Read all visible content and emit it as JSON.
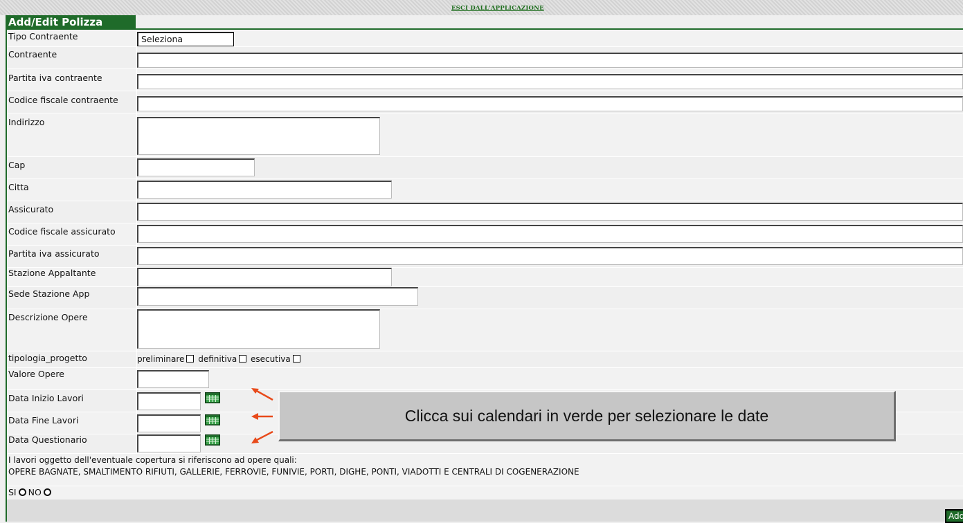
{
  "header": {
    "exit_link": "ESCI DALL'APPLICAZIONE",
    "title": "Add/Edit Polizza"
  },
  "form": {
    "tipo_contraente": {
      "label": "Tipo Contraente",
      "value": "Seleziona"
    },
    "contraente": {
      "label": "Contraente",
      "value": ""
    },
    "partita_iva_contraente": {
      "label": "Partita iva contraente",
      "value": ""
    },
    "codice_fiscale_contraente": {
      "label": "Codice fiscale contraente",
      "value": ""
    },
    "indirizzo": {
      "label": "Indirizzo",
      "value": ""
    },
    "cap": {
      "label": "Cap",
      "value": ""
    },
    "citta": {
      "label": "Citta",
      "value": ""
    },
    "assicurato": {
      "label": "Assicurato",
      "value": ""
    },
    "codice_fiscale_assicurato": {
      "label": "Codice fiscale assicurato",
      "value": ""
    },
    "partita_iva_assicurato": {
      "label": "Partita iva assicurato",
      "value": ""
    },
    "stazione_appaltante": {
      "label": "Stazione Appaltante",
      "value": ""
    },
    "sede_stazione_app": {
      "label": "Sede Stazione App",
      "value": ""
    },
    "descrizione_opere": {
      "label": "Descrizione Opere",
      "value": ""
    },
    "tipologia_progetto": {
      "label": "tipologia_progetto",
      "options": [
        "preliminare",
        "definitiva",
        "esecutiva"
      ]
    },
    "valore_opere": {
      "label": "Valore Opere",
      "value": ""
    },
    "data_inizio_lavori": {
      "label": "Data Inizio Lavori",
      "value": ""
    },
    "data_fine_lavori": {
      "label": "Data Fine Lavori",
      "value": ""
    },
    "data_questionario": {
      "label": "Data Questionario",
      "value": ""
    }
  },
  "question": {
    "line1": "I lavori oggetto dell'eventuale copertura si riferiscono ad opere quali:",
    "line2": "OPERE BAGNATE, SMALTIMENTO RIFIUTI, GALLERIE, FERROVIE, FUNIVIE, PORTI, DIGHE, PONTI, VIADOTTI E CENTRALI DI COGENERAZIONE",
    "si_label": "SI",
    "no_label": "NO"
  },
  "note": "Clicca sui calendari in verde per selezionare le date",
  "footer": {
    "add_button": "Add"
  },
  "colors": {
    "accent_green": "#1f6b2a",
    "arrow_orange": "#e84a1a"
  },
  "icons": [
    "calendar-icon",
    "arrow-icon"
  ]
}
